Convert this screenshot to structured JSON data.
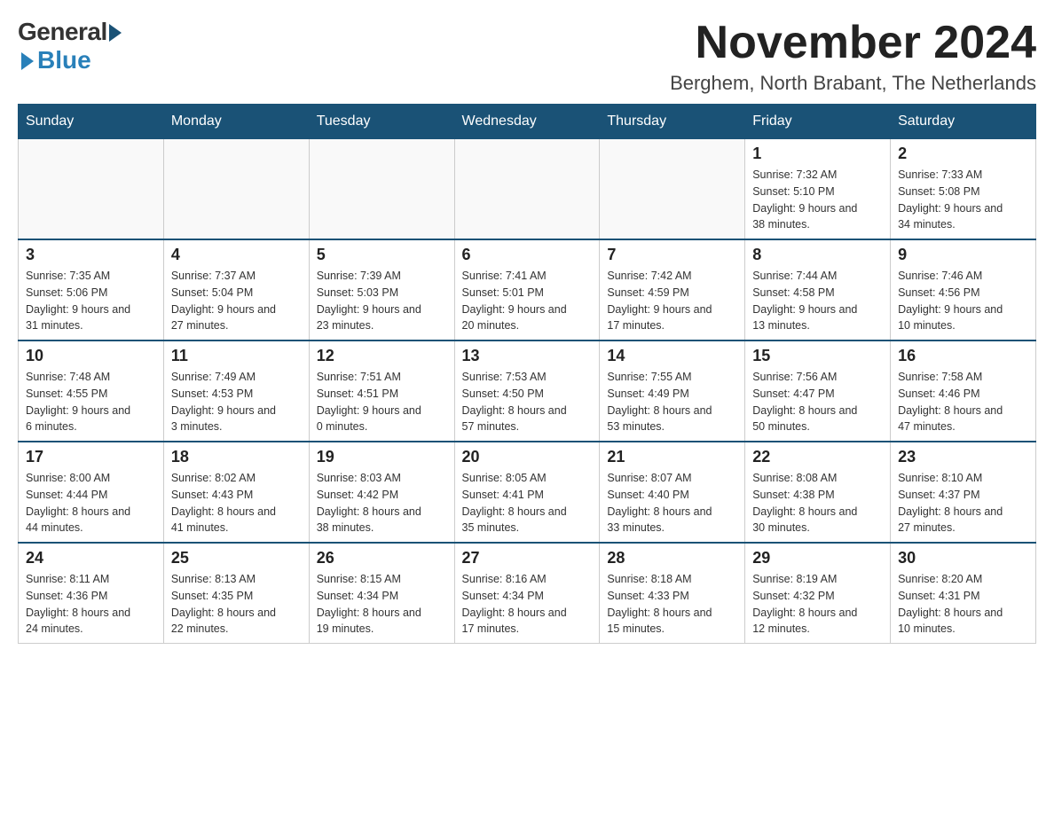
{
  "logo": {
    "general": "General",
    "blue": "Blue"
  },
  "title": "November 2024",
  "location": "Berghem, North Brabant, The Netherlands",
  "days_of_week": [
    "Sunday",
    "Monday",
    "Tuesday",
    "Wednesday",
    "Thursday",
    "Friday",
    "Saturday"
  ],
  "weeks": [
    [
      {
        "day": "",
        "sunrise": "",
        "sunset": "",
        "daylight": ""
      },
      {
        "day": "",
        "sunrise": "",
        "sunset": "",
        "daylight": ""
      },
      {
        "day": "",
        "sunrise": "",
        "sunset": "",
        "daylight": ""
      },
      {
        "day": "",
        "sunrise": "",
        "sunset": "",
        "daylight": ""
      },
      {
        "day": "",
        "sunrise": "",
        "sunset": "",
        "daylight": ""
      },
      {
        "day": "1",
        "sunrise": "Sunrise: 7:32 AM",
        "sunset": "Sunset: 5:10 PM",
        "daylight": "Daylight: 9 hours and 38 minutes."
      },
      {
        "day": "2",
        "sunrise": "Sunrise: 7:33 AM",
        "sunset": "Sunset: 5:08 PM",
        "daylight": "Daylight: 9 hours and 34 minutes."
      }
    ],
    [
      {
        "day": "3",
        "sunrise": "Sunrise: 7:35 AM",
        "sunset": "Sunset: 5:06 PM",
        "daylight": "Daylight: 9 hours and 31 minutes."
      },
      {
        "day": "4",
        "sunrise": "Sunrise: 7:37 AM",
        "sunset": "Sunset: 5:04 PM",
        "daylight": "Daylight: 9 hours and 27 minutes."
      },
      {
        "day": "5",
        "sunrise": "Sunrise: 7:39 AM",
        "sunset": "Sunset: 5:03 PM",
        "daylight": "Daylight: 9 hours and 23 minutes."
      },
      {
        "day": "6",
        "sunrise": "Sunrise: 7:41 AM",
        "sunset": "Sunset: 5:01 PM",
        "daylight": "Daylight: 9 hours and 20 minutes."
      },
      {
        "day": "7",
        "sunrise": "Sunrise: 7:42 AM",
        "sunset": "Sunset: 4:59 PM",
        "daylight": "Daylight: 9 hours and 17 minutes."
      },
      {
        "day": "8",
        "sunrise": "Sunrise: 7:44 AM",
        "sunset": "Sunset: 4:58 PM",
        "daylight": "Daylight: 9 hours and 13 minutes."
      },
      {
        "day": "9",
        "sunrise": "Sunrise: 7:46 AM",
        "sunset": "Sunset: 4:56 PM",
        "daylight": "Daylight: 9 hours and 10 minutes."
      }
    ],
    [
      {
        "day": "10",
        "sunrise": "Sunrise: 7:48 AM",
        "sunset": "Sunset: 4:55 PM",
        "daylight": "Daylight: 9 hours and 6 minutes."
      },
      {
        "day": "11",
        "sunrise": "Sunrise: 7:49 AM",
        "sunset": "Sunset: 4:53 PM",
        "daylight": "Daylight: 9 hours and 3 minutes."
      },
      {
        "day": "12",
        "sunrise": "Sunrise: 7:51 AM",
        "sunset": "Sunset: 4:51 PM",
        "daylight": "Daylight: 9 hours and 0 minutes."
      },
      {
        "day": "13",
        "sunrise": "Sunrise: 7:53 AM",
        "sunset": "Sunset: 4:50 PM",
        "daylight": "Daylight: 8 hours and 57 minutes."
      },
      {
        "day": "14",
        "sunrise": "Sunrise: 7:55 AM",
        "sunset": "Sunset: 4:49 PM",
        "daylight": "Daylight: 8 hours and 53 minutes."
      },
      {
        "day": "15",
        "sunrise": "Sunrise: 7:56 AM",
        "sunset": "Sunset: 4:47 PM",
        "daylight": "Daylight: 8 hours and 50 minutes."
      },
      {
        "day": "16",
        "sunrise": "Sunrise: 7:58 AM",
        "sunset": "Sunset: 4:46 PM",
        "daylight": "Daylight: 8 hours and 47 minutes."
      }
    ],
    [
      {
        "day": "17",
        "sunrise": "Sunrise: 8:00 AM",
        "sunset": "Sunset: 4:44 PM",
        "daylight": "Daylight: 8 hours and 44 minutes."
      },
      {
        "day": "18",
        "sunrise": "Sunrise: 8:02 AM",
        "sunset": "Sunset: 4:43 PM",
        "daylight": "Daylight: 8 hours and 41 minutes."
      },
      {
        "day": "19",
        "sunrise": "Sunrise: 8:03 AM",
        "sunset": "Sunset: 4:42 PM",
        "daylight": "Daylight: 8 hours and 38 minutes."
      },
      {
        "day": "20",
        "sunrise": "Sunrise: 8:05 AM",
        "sunset": "Sunset: 4:41 PM",
        "daylight": "Daylight: 8 hours and 35 minutes."
      },
      {
        "day": "21",
        "sunrise": "Sunrise: 8:07 AM",
        "sunset": "Sunset: 4:40 PM",
        "daylight": "Daylight: 8 hours and 33 minutes."
      },
      {
        "day": "22",
        "sunrise": "Sunrise: 8:08 AM",
        "sunset": "Sunset: 4:38 PM",
        "daylight": "Daylight: 8 hours and 30 minutes."
      },
      {
        "day": "23",
        "sunrise": "Sunrise: 8:10 AM",
        "sunset": "Sunset: 4:37 PM",
        "daylight": "Daylight: 8 hours and 27 minutes."
      }
    ],
    [
      {
        "day": "24",
        "sunrise": "Sunrise: 8:11 AM",
        "sunset": "Sunset: 4:36 PM",
        "daylight": "Daylight: 8 hours and 24 minutes."
      },
      {
        "day": "25",
        "sunrise": "Sunrise: 8:13 AM",
        "sunset": "Sunset: 4:35 PM",
        "daylight": "Daylight: 8 hours and 22 minutes."
      },
      {
        "day": "26",
        "sunrise": "Sunrise: 8:15 AM",
        "sunset": "Sunset: 4:34 PM",
        "daylight": "Daylight: 8 hours and 19 minutes."
      },
      {
        "day": "27",
        "sunrise": "Sunrise: 8:16 AM",
        "sunset": "Sunset: 4:34 PM",
        "daylight": "Daylight: 8 hours and 17 minutes."
      },
      {
        "day": "28",
        "sunrise": "Sunrise: 8:18 AM",
        "sunset": "Sunset: 4:33 PM",
        "daylight": "Daylight: 8 hours and 15 minutes."
      },
      {
        "day": "29",
        "sunrise": "Sunrise: 8:19 AM",
        "sunset": "Sunset: 4:32 PM",
        "daylight": "Daylight: 8 hours and 12 minutes."
      },
      {
        "day": "30",
        "sunrise": "Sunrise: 8:20 AM",
        "sunset": "Sunset: 4:31 PM",
        "daylight": "Daylight: 8 hours and 10 minutes."
      }
    ]
  ]
}
